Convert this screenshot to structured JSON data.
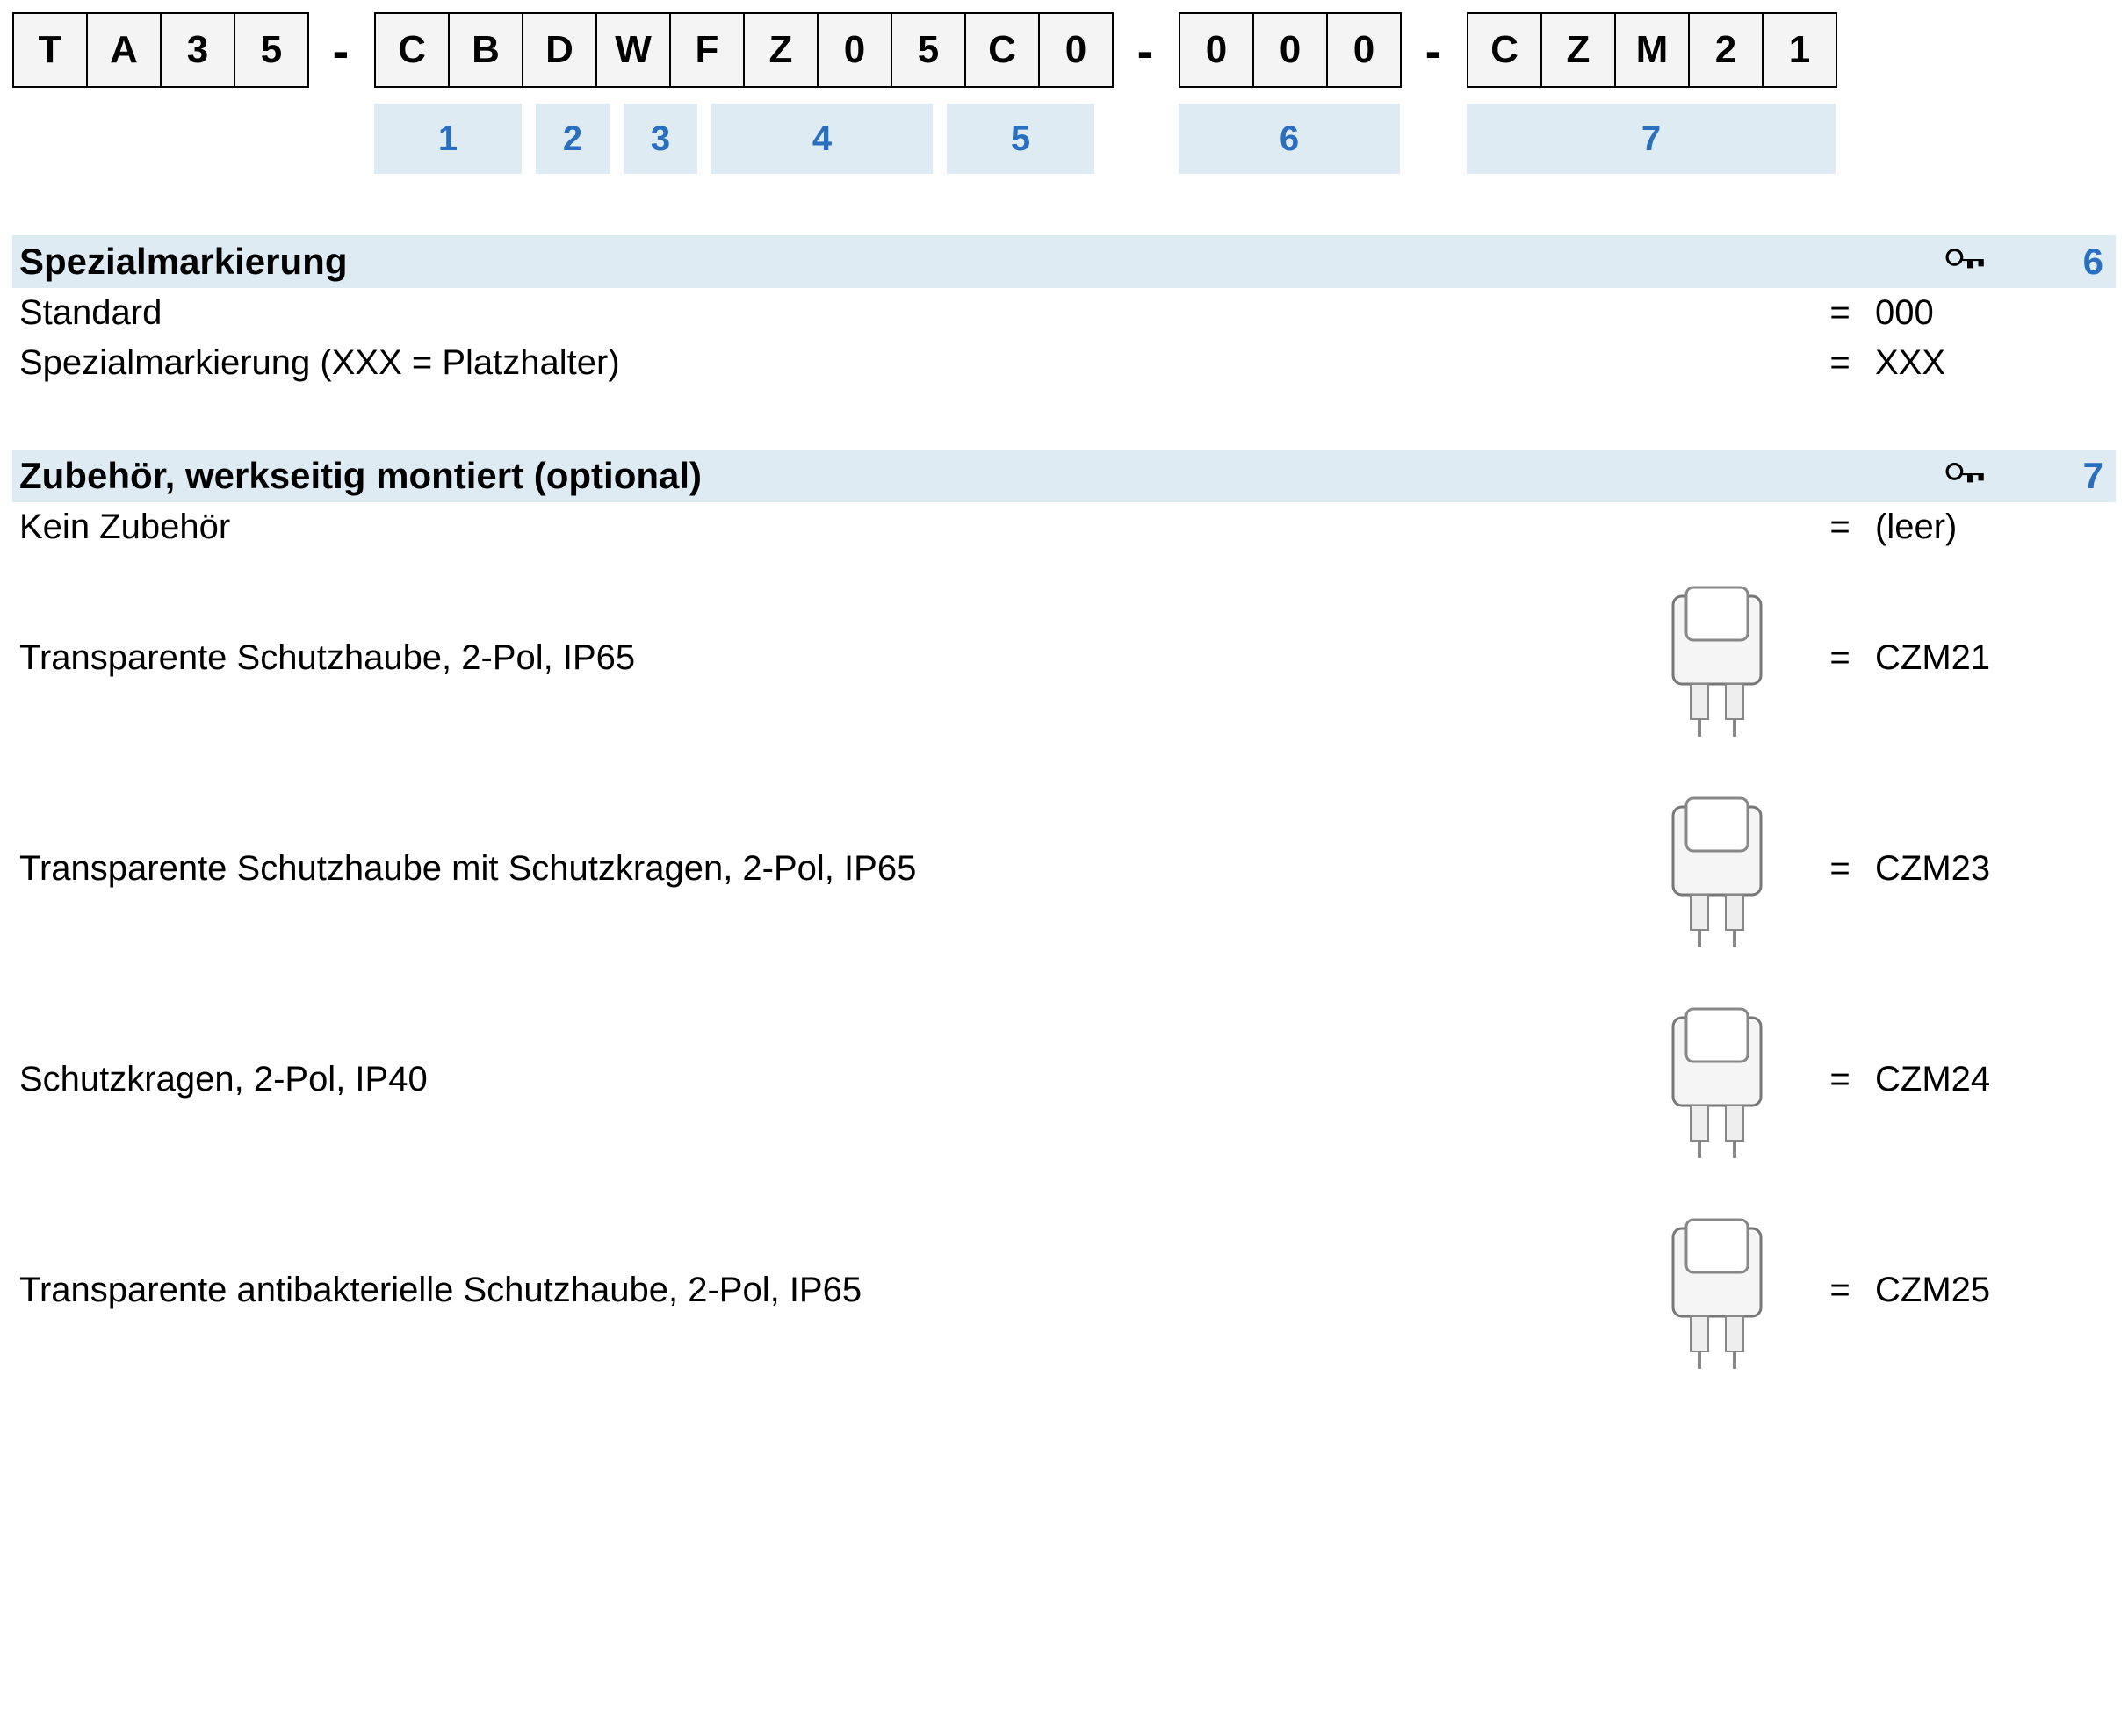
{
  "encoder": {
    "group1": [
      "T",
      "A",
      "3",
      "5"
    ],
    "group2": [
      "C",
      "B",
      "D",
      "W",
      "F",
      "Z",
      "0",
      "5",
      "C",
      "0"
    ],
    "group3": [
      "0",
      "0",
      "0"
    ],
    "group4": [
      "C",
      "Z",
      "M",
      "2",
      "1"
    ],
    "sep": "-",
    "legend": {
      "g2": [
        {
          "label": "1",
          "span": 2
        },
        {
          "label": "2",
          "span": 1
        },
        {
          "label": "3",
          "span": 1
        },
        {
          "label": "4",
          "span": 3
        },
        {
          "label": "5",
          "span": 2
        }
      ],
      "g3": {
        "label": "6",
        "span": 3
      },
      "g4": {
        "label": "7",
        "span": 5
      }
    }
  },
  "sections": [
    {
      "title": "Spezialmarkierung",
      "ref": "6",
      "rows": [
        {
          "desc": "Standard",
          "eq": "=",
          "code": "000",
          "thumb": false
        },
        {
          "desc": "Spezialmarkierung (XXX = Platzhalter)",
          "eq": "=",
          "code": "XXX",
          "thumb": false
        }
      ]
    },
    {
      "title": "Zubehör, werkseitig montiert (optional)",
      "ref": "7",
      "rows": [
        {
          "desc": "Kein Zubehör",
          "eq": "=",
          "code": "(leer)",
          "thumb": false
        },
        {
          "desc": "Transparente Schutzhaube,  2-Pol, IP65",
          "eq": "=",
          "code": "CZM21",
          "thumb": true
        },
        {
          "desc": "Transparente Schutzhaube mit Schutzkragen, 2-Pol, IP65",
          "eq": "=",
          "code": "CZM23",
          "thumb": true
        },
        {
          "desc": "Schutzkragen, 2-Pol, IP40",
          "eq": "=",
          "code": "CZM24",
          "thumb": true
        },
        {
          "desc": "Transparente antibakterielle Schutzhaube,  2-Pol, IP65",
          "eq": "=",
          "code": "CZM25",
          "thumb": true
        }
      ]
    }
  ]
}
